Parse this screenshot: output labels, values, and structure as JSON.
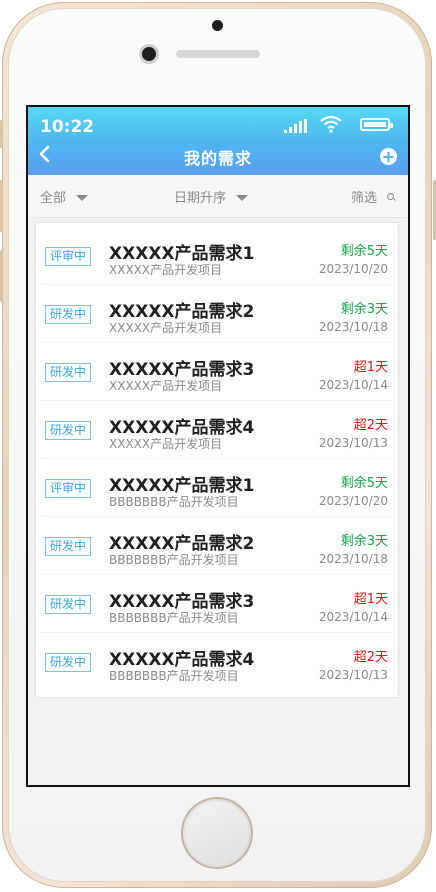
{
  "status": {
    "time": "10:22"
  },
  "nav": {
    "title": "我的需求",
    "back_icon": "chevron-left-icon",
    "add_icon": "plus-circle-icon"
  },
  "filters": {
    "all_label": "全部",
    "sort_label": "日期升序",
    "filter_label": "筛选"
  },
  "colors": {
    "green": "#1aa14a",
    "red": "#d41a1a",
    "tag": "#3aa7de",
    "nav": "#4fb5f0"
  },
  "items": [
    {
      "tag": "评审中",
      "title": "XXXXX产品需求1",
      "subtitle": "XXXXX产品开发项目",
      "remain": "剩余5天",
      "status": "green",
      "date": "2023/10/20"
    },
    {
      "tag": "研发中",
      "title": "XXXXX产品需求2",
      "subtitle": "XXXXX产品开发项目",
      "remain": "剩余3天",
      "status": "green",
      "date": "2023/10/18"
    },
    {
      "tag": "研发中",
      "title": "XXXXX产品需求3",
      "subtitle": "XXXXX产品开发项目",
      "remain": "超1天",
      "status": "red",
      "date": "2023/10/14"
    },
    {
      "tag": "研发中",
      "title": "XXXXX产品需求4",
      "subtitle": "XXXXX产品开发项目",
      "remain": "超2天",
      "status": "red",
      "date": "2023/10/13"
    },
    {
      "tag": "评审中",
      "title": "XXXXX产品需求1",
      "subtitle": "BBBBBBB产品开发项目",
      "remain": "剩余5天",
      "status": "green",
      "date": "2023/10/20"
    },
    {
      "tag": "研发中",
      "title": "XXXXX产品需求2",
      "subtitle": "BBBBBBB产品开发项目",
      "remain": "剩余3天",
      "status": "green",
      "date": "2023/10/18"
    },
    {
      "tag": "研发中",
      "title": "XXXXX产品需求3",
      "subtitle": "BBBBBBB产品开发项目",
      "remain": "超1天",
      "status": "red",
      "date": "2023/10/14"
    },
    {
      "tag": "研发中",
      "title": "XXXXX产品需求4",
      "subtitle": "BBBBBBB产品开发项目",
      "remain": "超2天",
      "status": "red",
      "date": "2023/10/13"
    }
  ]
}
